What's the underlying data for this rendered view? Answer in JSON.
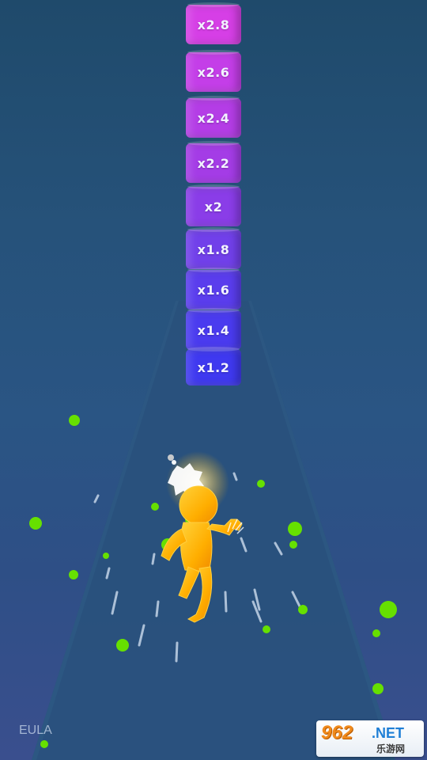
{
  "game": {
    "multipliers": [
      "x2.8",
      "x2.6",
      "x2.4",
      "x2.2",
      "x2",
      "x1.8",
      "x1.6",
      "x1.4",
      "x1.2"
    ],
    "segment_colors": [
      "#d63fe6",
      "#c43ee8",
      "#b43de6",
      "#a43ce6",
      "#8a3de8",
      "#7140ea",
      "#5a3ded",
      "#4a3bef",
      "#3f39f0"
    ]
  },
  "footer": {
    "eula_label": "EULA"
  },
  "watermark": {
    "brand": "962",
    "domain": ".NET",
    "subtitle": "乐游网"
  },
  "colors": {
    "character": "#ffb400",
    "particles": "#66e000",
    "road": "#29517c"
  },
  "icons": [
    "running-character-icon",
    "paint-splat-icon"
  ]
}
